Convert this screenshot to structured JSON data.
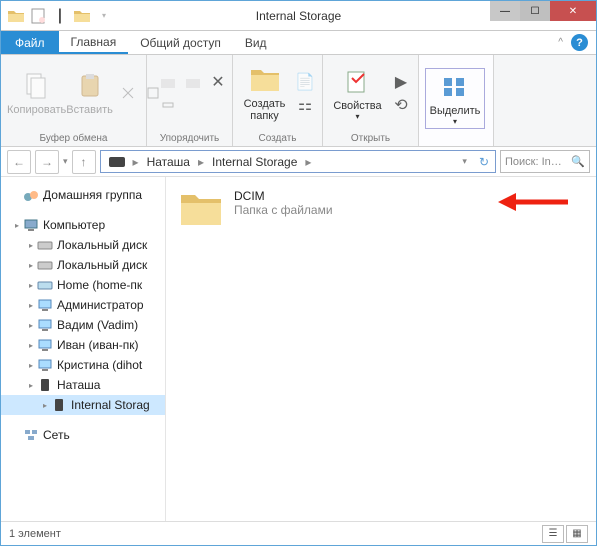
{
  "window": {
    "title": "Internal Storage"
  },
  "qat": {
    "items": [
      "folder-icon",
      "new-doc-icon",
      "open-folder-icon",
      "dropdown-icon"
    ]
  },
  "tabs": {
    "file": "Файл",
    "items": [
      "Главная",
      "Общий доступ",
      "Вид"
    ],
    "active_index": 0
  },
  "ribbon": {
    "groups": [
      {
        "label": "Буфер обмена",
        "buttons": [
          {
            "label": "Копировать",
            "icon": "copy-icon",
            "enabled": false
          },
          {
            "label": "Вставить",
            "icon": "paste-icon",
            "enabled": false
          }
        ]
      },
      {
        "label": "Упорядочить",
        "buttons": []
      },
      {
        "label": "Создать",
        "create_label": "Создать\nпапку",
        "buttons": []
      },
      {
        "label": "Открыть",
        "props_label": "Свойства",
        "buttons": []
      },
      {
        "label": "",
        "select_label": "Выделить",
        "buttons": []
      }
    ]
  },
  "breadcrumb": {
    "segments": [
      "Наташа",
      "Internal Storage"
    ]
  },
  "search": {
    "placeholder": "Поиск: In…"
  },
  "tree": {
    "items": [
      {
        "label": "Домашняя группа",
        "icon": "homegroup-icon",
        "indent": 0
      },
      {
        "spacer": true
      },
      {
        "label": "Компьютер",
        "icon": "computer-icon",
        "indent": 0
      },
      {
        "label": "Локальный диск",
        "icon": "disk-icon",
        "indent": 1
      },
      {
        "label": "Локальный диск",
        "icon": "disk-icon",
        "indent": 1
      },
      {
        "label": "Home (home-пк",
        "icon": "netdrive-icon",
        "indent": 1
      },
      {
        "label": "Администратор",
        "icon": "netfolder-icon",
        "indent": 1
      },
      {
        "label": "Вадим (Vadim)",
        "icon": "netfolder-icon",
        "indent": 1
      },
      {
        "label": "Иван (иван-пк)",
        "icon": "netfolder-icon",
        "indent": 1
      },
      {
        "label": "Кристина (dihot",
        "icon": "netfolder-icon",
        "indent": 1
      },
      {
        "label": "Наташа",
        "icon": "phone-icon",
        "indent": 1
      },
      {
        "label": "Internal Storag",
        "icon": "phone-icon",
        "indent": 2,
        "selected": true
      },
      {
        "spacer": true
      },
      {
        "label": "Сеть",
        "icon": "network-icon",
        "indent": 0
      }
    ]
  },
  "content": {
    "item": {
      "name": "DCIM",
      "subtitle": "Папка с файлами"
    }
  },
  "status": {
    "text": "1 элемент"
  }
}
